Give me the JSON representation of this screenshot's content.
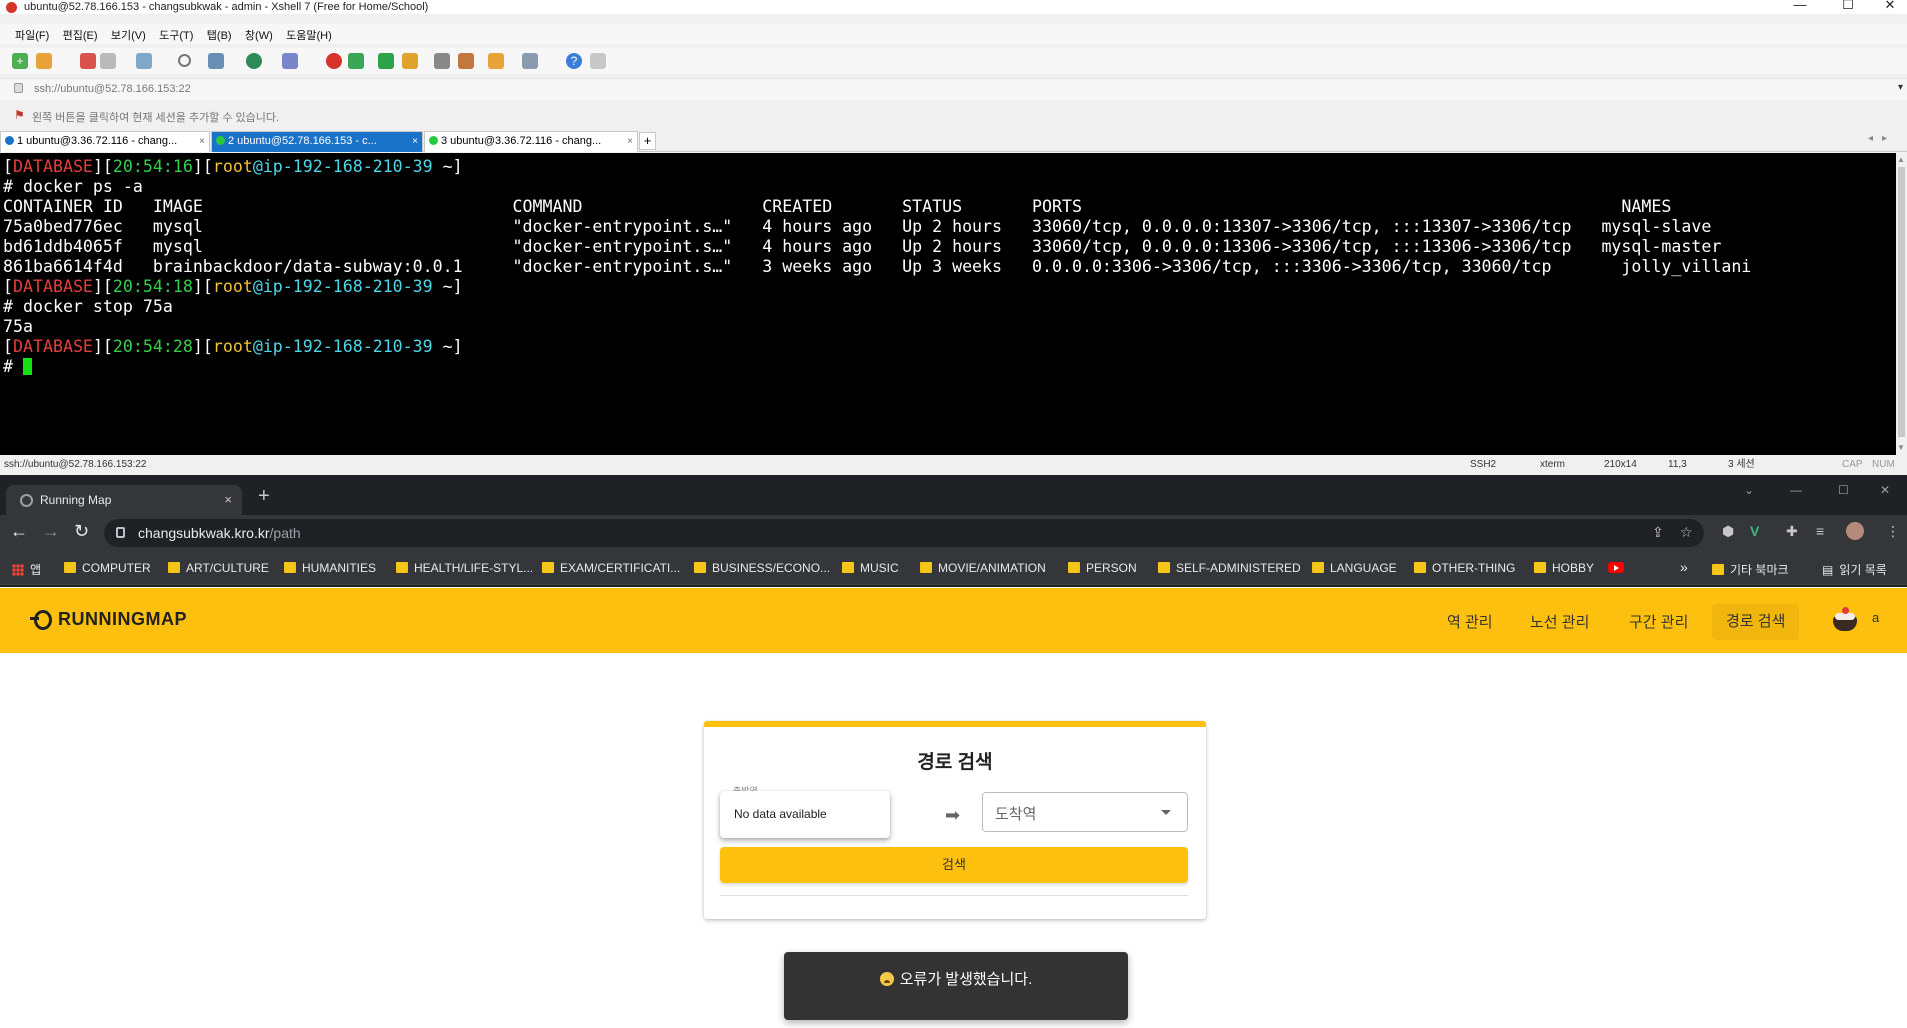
{
  "xshell": {
    "title": "ubuntu@52.78.166.153 - changsubkwak - admin - Xshell 7 (Free for Home/School)",
    "window_controls": {
      "minimize": "—",
      "maximize": "☐",
      "close": "✕"
    },
    "menu": [
      "파일(F)",
      "편집(E)",
      "보기(V)",
      "도구(T)",
      "탭(B)",
      "창(W)",
      "도움말(H)"
    ],
    "address": "ssh://ubuntu@52.78.166.153:22",
    "info_text": "왼쪽 버튼을 클릭하여 현재 세션을 추가할 수 있습니다.",
    "tabs": [
      {
        "label": "1 ubuntu@3.36.72.116 - chang...",
        "status": "info",
        "active": false
      },
      {
        "label": "2 ubuntu@52.78.166.153 - c...",
        "status": "connected",
        "active": true
      },
      {
        "label": "3 ubuntu@3.36.72.116 - chang...",
        "status": "connected",
        "active": false
      }
    ],
    "tab_add": "+",
    "terminal": {
      "prompts": [
        {
          "host_tag": "DATABASE",
          "time": "20:54:16",
          "user": "root",
          "host": "ip-192-168-210-39",
          "dir": "~"
        },
        {
          "host_tag": "DATABASE",
          "time": "20:54:18",
          "user": "root",
          "host": "ip-192-168-210-39",
          "dir": "~"
        },
        {
          "host_tag": "DATABASE",
          "time": "20:54:28",
          "user": "root",
          "host": "ip-192-168-210-39",
          "dir": "~"
        }
      ],
      "cmd1": "# docker ps -a",
      "ps_header": "CONTAINER ID   IMAGE                               COMMAND                  CREATED       STATUS       PORTS                                                      NAMES",
      "ps_rows": [
        "75a0bed776ec   mysql                               \"docker-entrypoint.s…\"   4 hours ago   Up 2 hours   33060/tcp, 0.0.0.0:13307->3306/tcp, :::13307->3306/tcp   mysql-slave",
        "bd61ddb4065f   mysql                               \"docker-entrypoint.s…\"   4 hours ago   Up 2 hours   33060/tcp, 0.0.0.0:13306->3306/tcp, :::13306->3306/tcp   mysql-master",
        "861ba6614f4d   brainbackdoor/data-subway:0.0.1     \"docker-entrypoint.s…\"   3 weeks ago   Up 3 weeks   0.0.0.0:3306->3306/tcp, :::3306->3306/tcp, 33060/tcp       jolly_villani"
      ],
      "cmd2": "# docker stop 75a",
      "out2": "75a",
      "cmd3": "# "
    },
    "status": {
      "address": "ssh://ubuntu@52.78.166.153:22",
      "protocol": "SSH2",
      "term": "xterm",
      "size": "210x14",
      "pos": "11,3",
      "sessions": "3 세션",
      "cap": "CAP",
      "num": "NUM"
    }
  },
  "chrome": {
    "tab_title": "Running Map",
    "tab_close": "×",
    "new_tab": "+",
    "url_host": "changsubkwak.kro.kr",
    "url_path": "/path",
    "bookmarks": [
      "앱",
      "COMPUTER",
      "ART/CULTURE",
      "HUMANITIES",
      "HEALTH/LIFE-STYL...",
      "EXAM/CERTIFICATI...",
      "BUSINESS/ECONO...",
      "MUSIC",
      "MOVIE/ANIMATION",
      "PERSON",
      "SELF-ADMINISTERED",
      "LANGUAGE",
      "OTHER-THING",
      "HOBBY"
    ],
    "bookmarks_more": "»",
    "other_bookmarks": "기타 북마크",
    "reading_list": "읽기 목록"
  },
  "page": {
    "brand": "RUNNINGMAP",
    "nav": [
      "역 관리",
      "노선 관리",
      "구간 관리",
      "경로 검색"
    ],
    "user": "a",
    "card_title": "경로 검색",
    "source_label": "출발역",
    "no_data": "No data available",
    "dest_placeholder": "도착역",
    "search_button": "검색",
    "snackbar": "오류가 발생했습니다."
  },
  "colors": {
    "accent": "#fec00e",
    "xshell_active_tab": "#1a72c9",
    "terminal_bg": "#000000",
    "chrome_bg": "#202124"
  }
}
